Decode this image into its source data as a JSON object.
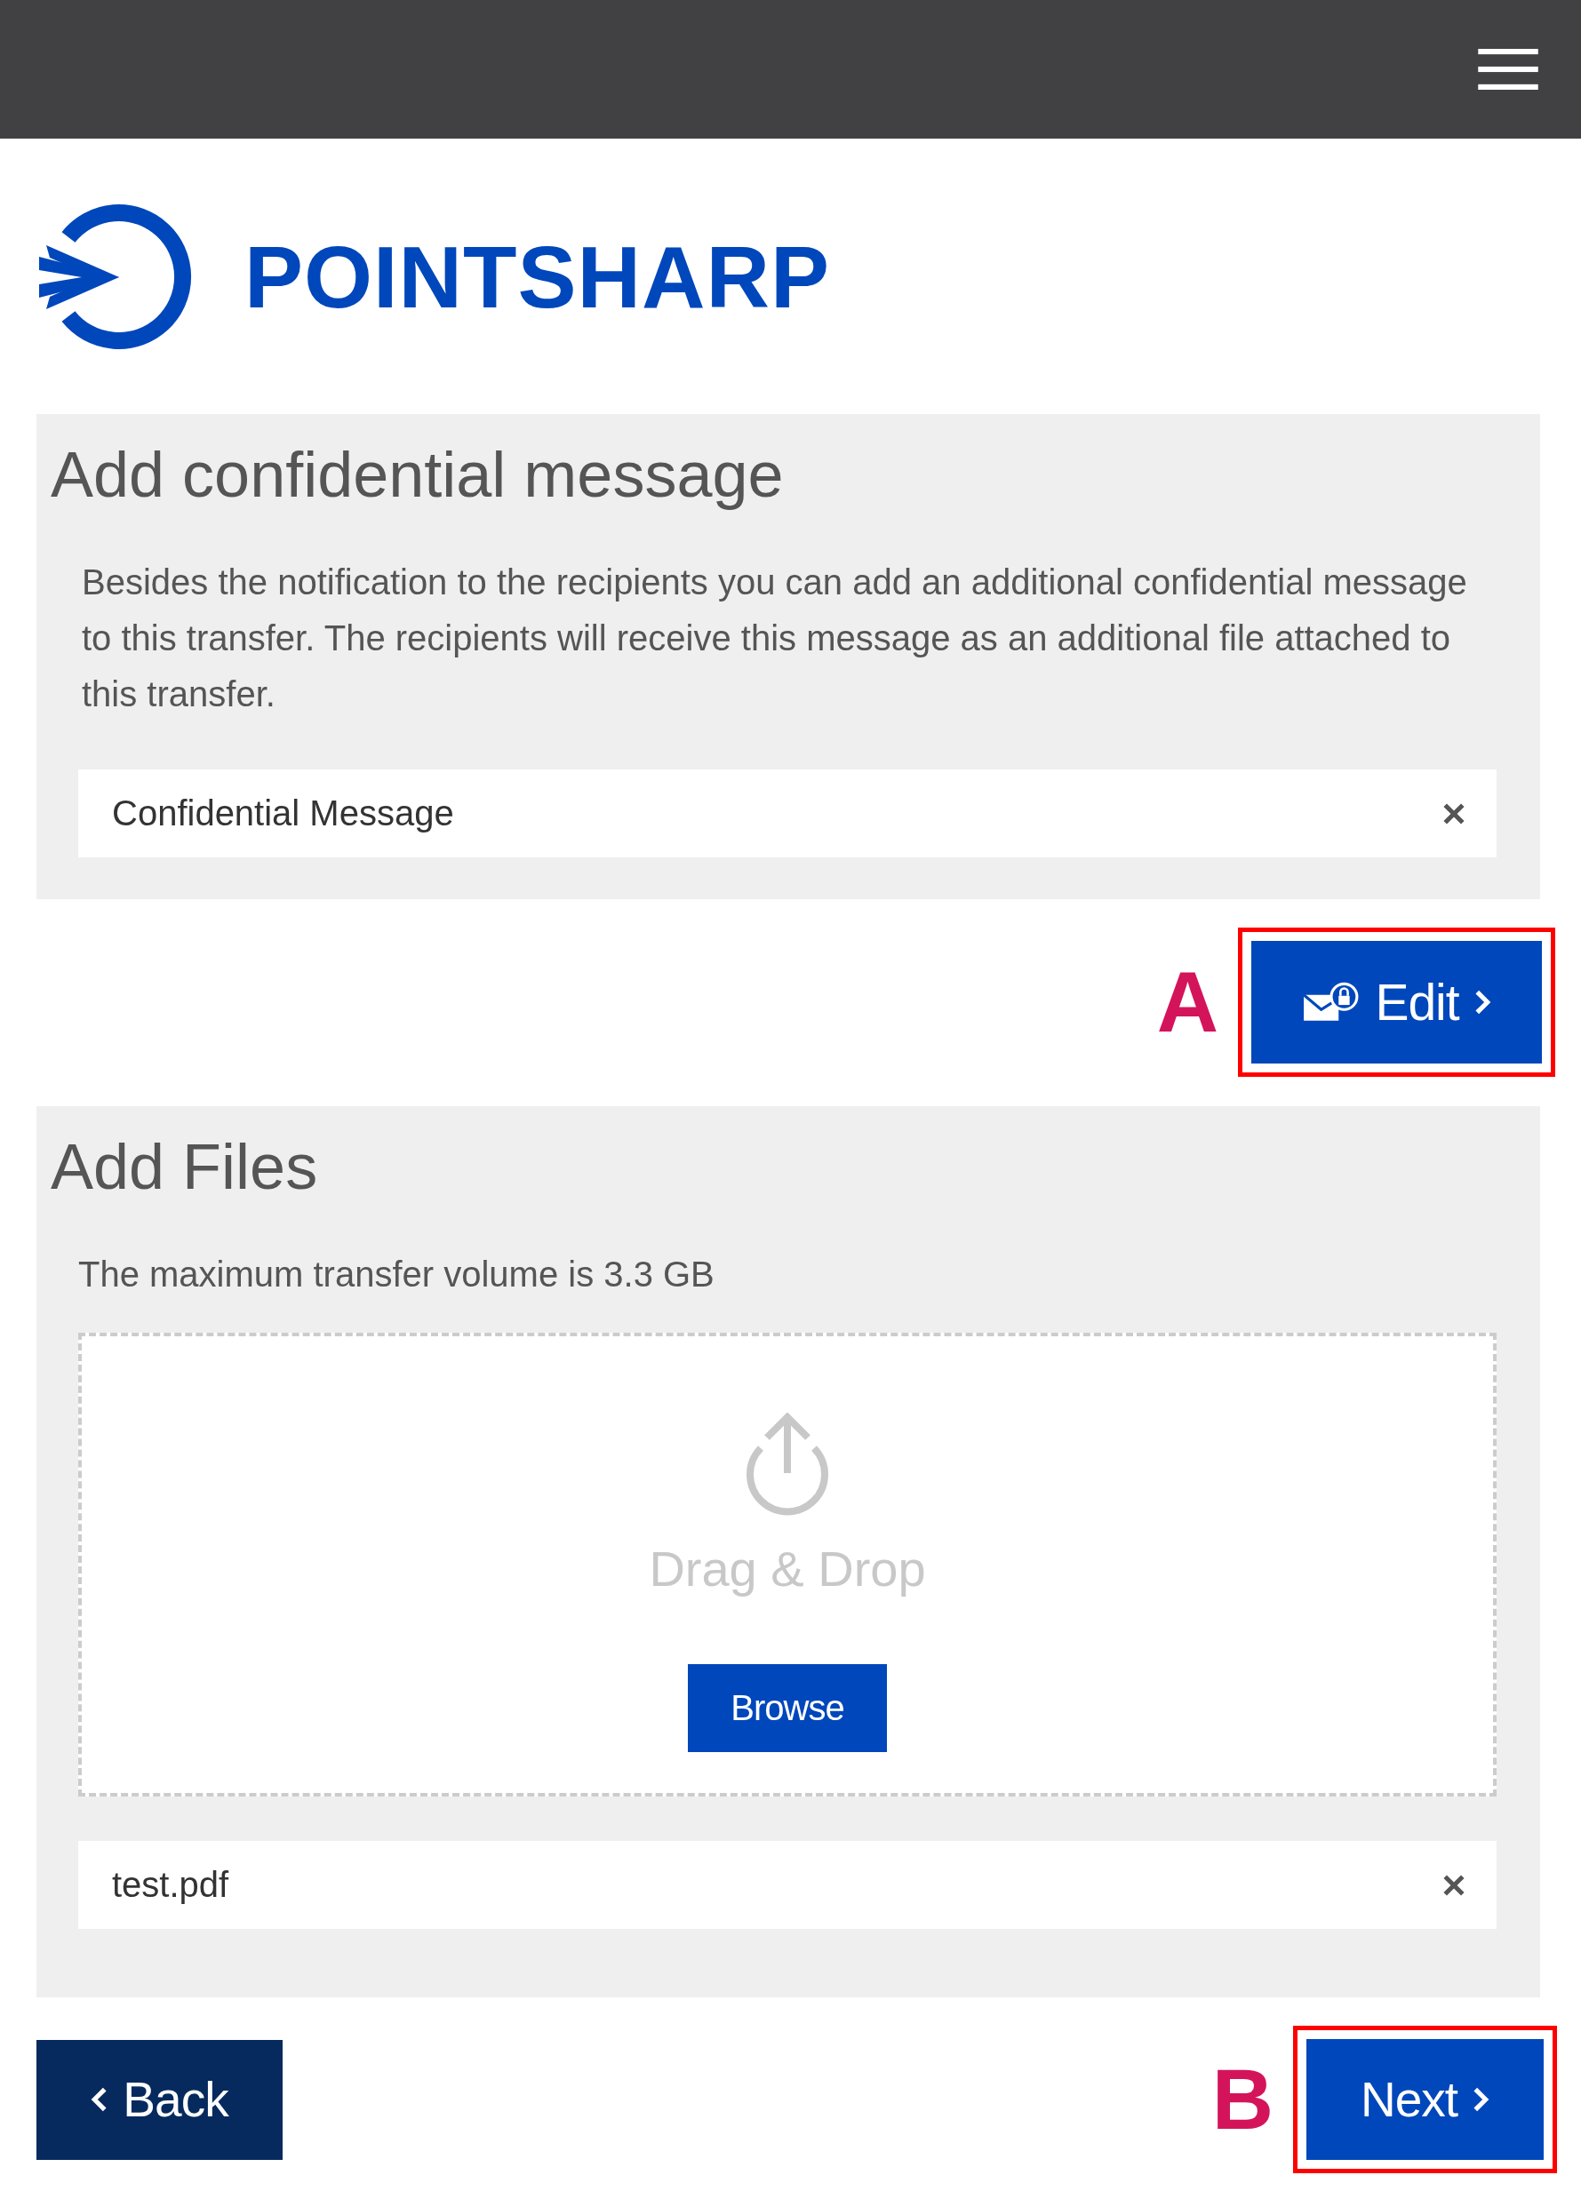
{
  "logo": {
    "text": "POINTSHARP"
  },
  "message_panel": {
    "title": "Add confidential message",
    "description": "Besides the notification to the recipients you can add an additional confidential message to this transfer. The recipients will receive this message as an additional file attached to this transfer.",
    "field": {
      "value": "Confidential Message"
    },
    "edit_button": {
      "label": "Edit",
      "annotation": "A",
      "highlighted": true
    }
  },
  "files_panel": {
    "title": "Add Files",
    "note": "The maximum transfer volume is 3.3 GB",
    "dropzone": {
      "label": "Drag & Drop",
      "browse_button": "Browse"
    },
    "files": [
      {
        "name": "test.pdf"
      }
    ]
  },
  "footer": {
    "back_button": {
      "label": "Back"
    },
    "next_button": {
      "label": "Next",
      "annotation": "B",
      "highlighted": true
    }
  }
}
